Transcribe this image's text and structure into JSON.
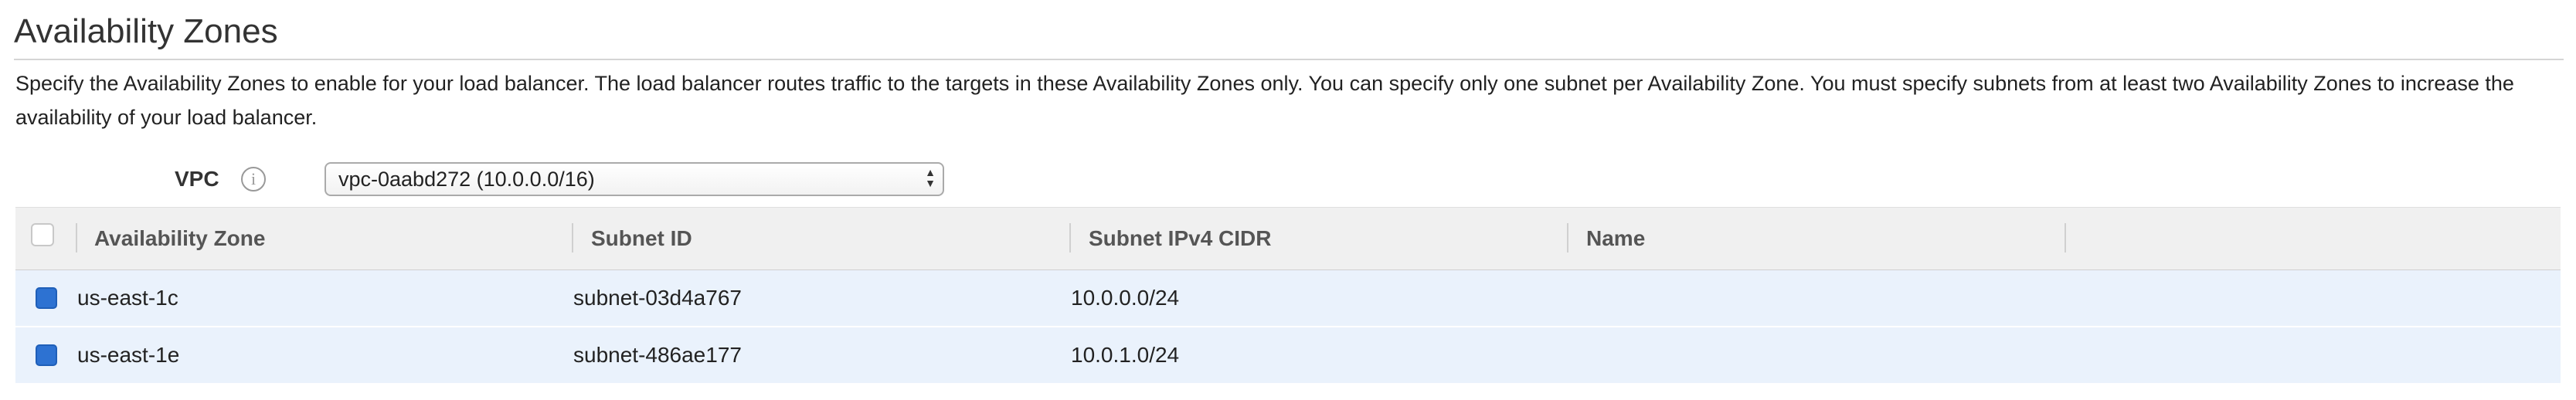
{
  "section": {
    "title": "Availability Zones",
    "description": "Specify the Availability Zones to enable for your load balancer. The load balancer routes traffic to the targets in these Availability Zones only. You can specify only one subnet per Availability Zone. You must specify subnets from at least two Availability Zones to increase the availability of your load balancer."
  },
  "vpc": {
    "label": "VPC",
    "info_icon": "info-icon",
    "selected": "vpc-0aabd272 (10.0.0.0/16)"
  },
  "table": {
    "columns": [
      "Availability Zone",
      "Subnet ID",
      "Subnet IPv4 CIDR",
      "Name"
    ],
    "rows": [
      {
        "zone": "us-east-1c",
        "subnet_id": "subnet-03d4a767",
        "cidr": "10.0.0.0/24",
        "name": "",
        "checked": true
      },
      {
        "zone": "us-east-1e",
        "subnet_id": "subnet-486ae177",
        "cidr": "10.0.1.0/24",
        "name": "",
        "checked": true
      }
    ]
  },
  "colors": {
    "selected_row_bg": "#eaf2fc",
    "checkbox_checked": "#2d72d2",
    "header_bg": "#f0f0f0"
  }
}
